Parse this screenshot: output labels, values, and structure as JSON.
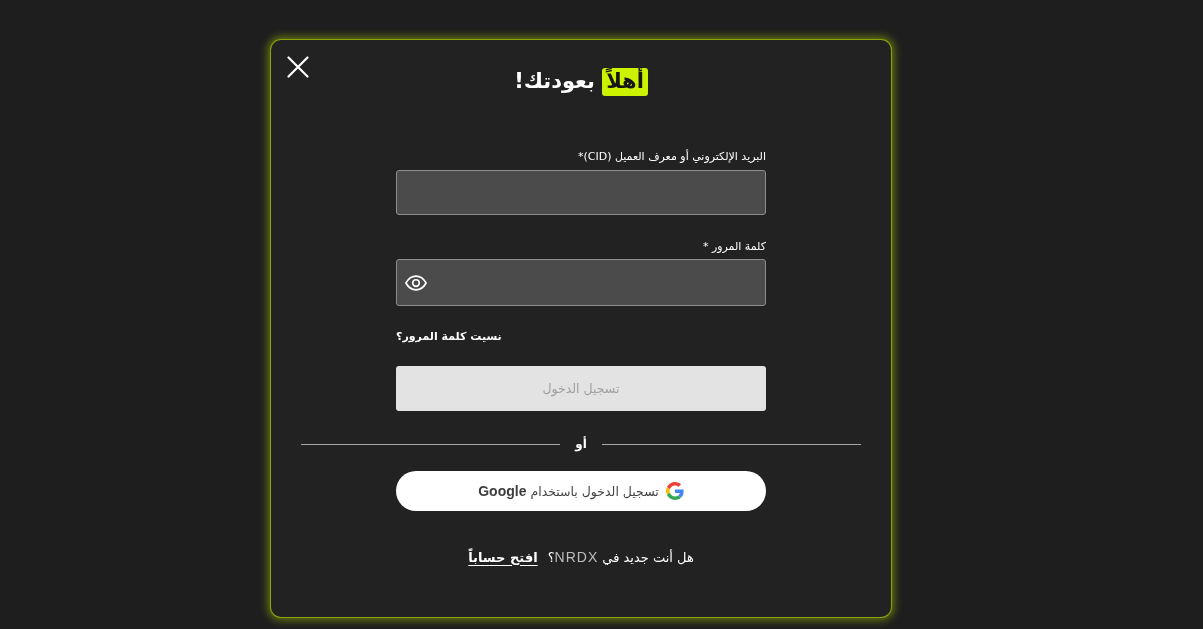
{
  "dialog": {
    "title": {
      "highlight": "أهلاً",
      "text": "بعودتك!"
    },
    "fields": [
      {
        "kind": "text",
        "label": "البريد الإلكتروني أو معرف العميل (CID)*"
      },
      {
        "kind": "password",
        "label": "كلمة المرور *"
      }
    ],
    "forgot_password_link": "نسيت كلمة المرور؟",
    "login_button": {
      "label": "تسجيل الدخول",
      "disabled": true
    },
    "divider_text": "أو",
    "google_button": {
      "label": "تسجيل الدخول باستخدام **Google**"
    },
    "signup": {
      "prompt_before": "هل أنت جديد في",
      "brand": "NRDX",
      "prompt_after": "؟",
      "link": "افتح حساباً"
    }
  }
}
